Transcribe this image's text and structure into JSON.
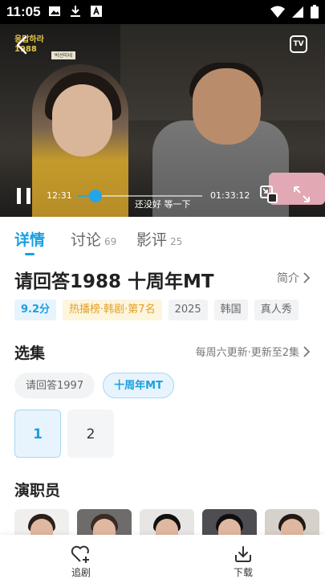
{
  "status_bar": {
    "time": "11:05"
  },
  "video": {
    "logo_text": "응답하라 1988",
    "badge_text": "박선미네",
    "tv_label": "TV",
    "current_time": "12:31",
    "total_time": "01:33:12",
    "tooltip": "还没好 等一下",
    "progress": 0.14
  },
  "tabs": [
    {
      "label": "详情",
      "count": ""
    },
    {
      "label": "讨论",
      "count": "69"
    },
    {
      "label": "影评",
      "count": "25"
    }
  ],
  "detail": {
    "title": "请回答1988 十周年MT",
    "intro_label": "简介",
    "tags": [
      "9.2分",
      "热播榜·韩剧·第7名",
      "2025",
      "韩国",
      "真人秀"
    ]
  },
  "episodes": {
    "title": "选集",
    "update_text": "每周六更新·更新至2集",
    "seasons": [
      "请回答1997",
      "十周年MT"
    ],
    "items": [
      "1",
      "2"
    ]
  },
  "cast": {
    "title": "演职员"
  },
  "bottom_bar": {
    "follow_label": "追剧",
    "download_label": "下载"
  },
  "colors": {
    "accent": "#1a9fe0",
    "hot": "#e0a12a"
  }
}
